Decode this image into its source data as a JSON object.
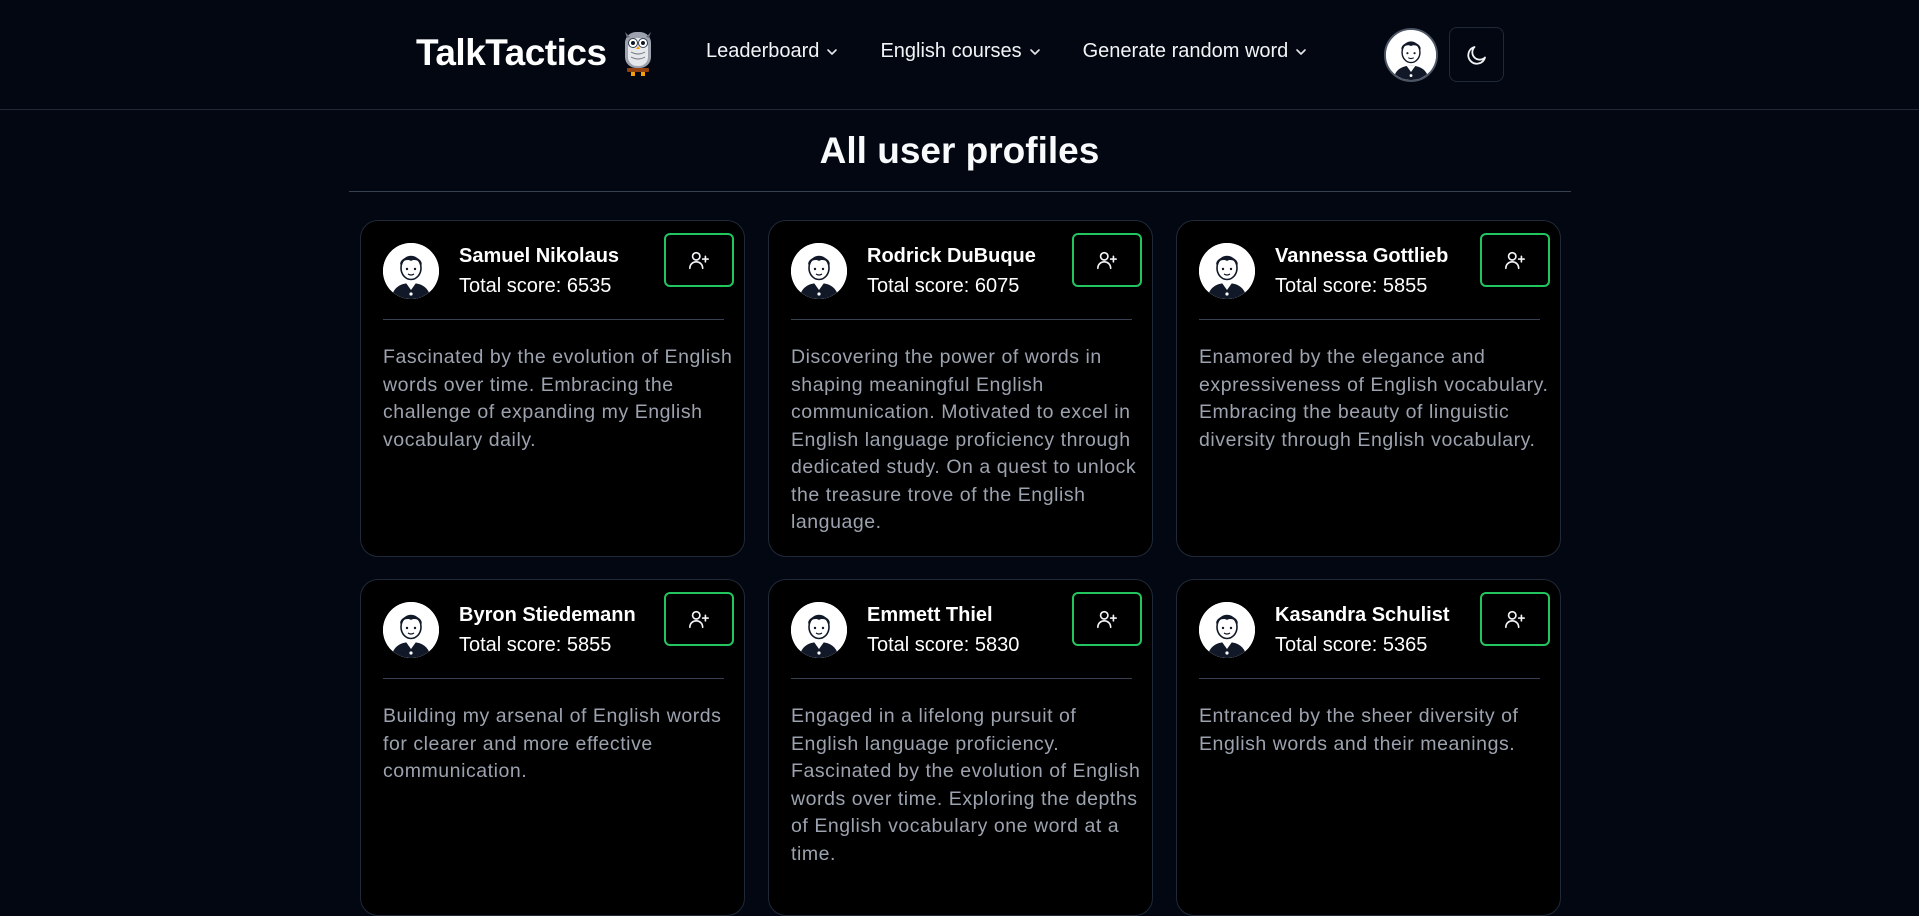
{
  "brand": {
    "name": "TalkTactics",
    "logo_icon": "owl-icon"
  },
  "nav": {
    "items": [
      {
        "label": "Leaderboard",
        "icon": "chevron-down-icon"
      },
      {
        "label": "English courses",
        "icon": "chevron-down-icon"
      },
      {
        "label": "Generate random word",
        "icon": "chevron-down-icon"
      }
    ],
    "theme_icon": "moon-icon"
  },
  "page": {
    "title": "All user profiles"
  },
  "profiles": [
    {
      "name": "Samuel Nikolaus",
      "score": "Total score: 6535",
      "bio": "Fascinated by the evolution of English words over time. Embracing the challenge of expanding my English vocabulary daily."
    },
    {
      "name": "Rodrick DuBuque",
      "score": "Total score: 6075",
      "bio": "Discovering the power of words in shaping meaningful English communication. Motivated to excel in English language proficiency through dedicated study. On a quest to unlock the treasure trove of the English language."
    },
    {
      "name": "Vannessa Gottlieb",
      "score": "Total score: 5855",
      "bio": "Enamored by the elegance and expressiveness of English vocabulary. Embracing the beauty of linguistic diversity through English vocabulary."
    },
    {
      "name": "Byron Stiedemann",
      "score": "Total score: 5855",
      "bio": "Building my arsenal of English words for clearer and more effective communication."
    },
    {
      "name": "Emmett Thiel",
      "score": "Total score: 5830",
      "bio": "Engaged in a lifelong pursuit of English language proficiency. Fascinated by the evolution of English words over time. Exploring the depths of English vocabulary one word at a time."
    },
    {
      "name": "Kasandra Schulist",
      "score": "Total score: 5365",
      "bio": "Entranced by the sheer diversity of English words and their meanings."
    }
  ],
  "colors": {
    "background": "#030712",
    "accent": "#22c55e",
    "muted_text": "#9ca3af",
    "border": "#1f2937"
  }
}
